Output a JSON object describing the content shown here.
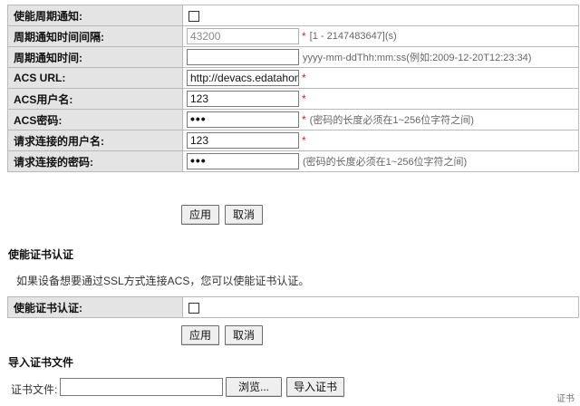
{
  "config_rows": [
    {
      "label": "使能周期通知:",
      "type": "checkbox"
    },
    {
      "label": "周期通知时间间隔:",
      "type": "text",
      "value": "43200",
      "disabled": true,
      "required": true,
      "hint": "[1 - 2147483647](s)"
    },
    {
      "label": "周期通知时间:",
      "type": "text",
      "value": "",
      "required": false,
      "hint": "yyyy-mm-ddThh:mm:ss(例如:2009-12-20T12:23:34)"
    },
    {
      "label": "ACS URL:",
      "type": "text",
      "value": "http://devacs.edatahome",
      "required": true,
      "hint": ""
    },
    {
      "label": "ACS用户名:",
      "type": "text",
      "value": "123",
      "required": true,
      "hint": ""
    },
    {
      "label": "ACS密码:",
      "type": "password",
      "value": "•••",
      "required": true,
      "hint": "(密码的长度必须在1~256位字符之间)"
    },
    {
      "label": "请求连接的用户名:",
      "type": "text",
      "value": "123",
      "required": true,
      "hint": ""
    },
    {
      "label": "请求连接的密码:",
      "type": "password",
      "value": "•••",
      "required": false,
      "hint": "(密码的长度必须在1~256位字符之间)"
    }
  ],
  "required_mark": "*",
  "buttons": {
    "apply": "应用",
    "cancel": "取消"
  },
  "cert_section": {
    "title": "使能证书认证",
    "description": "如果设备想要通过SSL方式连接ACS，您可以使能证书认证。",
    "row_label": "使能证书认证:"
  },
  "import_section": {
    "title": "导入证书文件",
    "file_label": "证书文件:",
    "browse_label": "浏览...",
    "import_label": "导入证书"
  },
  "watermark": "证书"
}
